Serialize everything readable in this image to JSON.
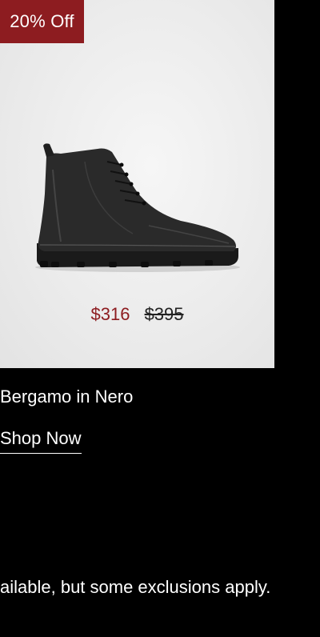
{
  "product": {
    "badge": "20% Off",
    "image_name": "black-lace-up-boot",
    "price_sale": "$316",
    "price_original": "$395",
    "name": "Bergamo in Nero",
    "cta_label": "Shop Now"
  },
  "footer": {
    "disclaimer": "ailable, but some exclusions apply."
  },
  "colors": {
    "badge_bg": "#8d1c20",
    "sale_price": "#8d1c20",
    "page_bg": "#000000",
    "card_bg": "#ececec"
  }
}
